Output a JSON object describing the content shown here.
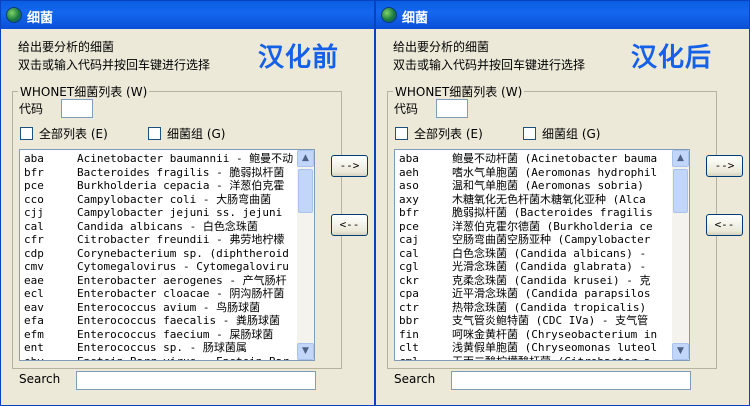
{
  "windows": [
    {
      "title": "细菌",
      "instruction_line1": "给出要分析的细菌",
      "instruction_line2": "双击或输入代码并按回车键进行选择",
      "badge": "汉化前",
      "group_label": "WHONET细菌列表 (W)",
      "code_label": "代码",
      "full_list_label": "全部列表 (E)",
      "group_checkbox_label": "细菌组 (G)",
      "add_button": "-->",
      "remove_button": "<--",
      "search_label": "Search",
      "items": [
        {
          "code": "aba",
          "desc": "Acinetobacter baumannii - 鲍曼不动"
        },
        {
          "code": "bfr",
          "desc": "Bacteroides fragilis - 脆弱拟杆菌"
        },
        {
          "code": "pce",
          "desc": "Burkholderia cepacia - 洋葱伯克霍"
        },
        {
          "code": "cco",
          "desc": "Campylobacter coli - 大肠弯曲菌"
        },
        {
          "code": "cjj",
          "desc": "Campylobacter jejuni ss. jejuni"
        },
        {
          "code": "cal",
          "desc": "Candida albicans - 白色念珠菌"
        },
        {
          "code": "cfr",
          "desc": "Citrobacter freundii - 弗劳地柠檬"
        },
        {
          "code": "cdp",
          "desc": "Corynebacterium sp. (diphtheroid"
        },
        {
          "code": "cmv",
          "desc": "Cytomegalovirus - Cytomegaloviru"
        },
        {
          "code": "eae",
          "desc": "Enterobacter aerogenes - 产气肠杆"
        },
        {
          "code": "ecl",
          "desc": "Enterobacter cloacae - 阴沟肠杆菌"
        },
        {
          "code": "eav",
          "desc": "Enterococcus avium - 鸟肠球菌"
        },
        {
          "code": "efa",
          "desc": "Enterococcus faecalis - 粪肠球菌"
        },
        {
          "code": "efm",
          "desc": "Enterococcus faecium - 屎肠球菌"
        },
        {
          "code": "ent",
          "desc": "Enterococcus sp. - 肠球菌属"
        },
        {
          "code": "ebv",
          "desc": "Epstein-Barr virus - Epstein-Bar"
        }
      ]
    },
    {
      "title": "细菌",
      "instruction_line1": "给出要分析的细菌",
      "instruction_line2": "双击或输入代码并按回车键进行选择",
      "badge": "汉化后",
      "group_label": "WHONET细菌列表 (W)",
      "code_label": "代码",
      "full_list_label": "全部列表 (E)",
      "group_checkbox_label": "细菌组 (G)",
      "add_button": "-->",
      "remove_button": "<--",
      "search_label": "Search",
      "items": [
        {
          "code": "aba",
          "desc": "鲍曼不动杆菌 (Acinetobacter bauma"
        },
        {
          "code": "aeh",
          "desc": "嗜水气单胞菌 (Aeromonas hydrophil"
        },
        {
          "code": "aso",
          "desc": "温和气单胞菌 (Aeromonas sobria)"
        },
        {
          "code": "axy",
          "desc": "木糖氧化无色杆菌木糖氧化亚种 (Alca"
        },
        {
          "code": "bfr",
          "desc": "脆弱拟杆菌 (Bacteroides fragilis"
        },
        {
          "code": "pce",
          "desc": "洋葱伯克霍尔德菌 (Burkholderia ce"
        },
        {
          "code": "caj",
          "desc": "空肠弯曲菌空肠亚种 (Campylobacter"
        },
        {
          "code": "cal",
          "desc": "白色念珠菌 (Candida albicans) -"
        },
        {
          "code": "cgl",
          "desc": "光滑念珠菌 (Candida glabrata) -"
        },
        {
          "code": "ckr",
          "desc": "克柔念珠菌 (Candida krusei) - 克"
        },
        {
          "code": "cpa",
          "desc": "近平滑念珠菌 (Candida parapsilos"
        },
        {
          "code": "ctr",
          "desc": "热带念珠菌 (Candida tropicalis)"
        },
        {
          "code": "bbr",
          "desc": "支气管炎鲍特菌 (CDC IVa) - 支气管"
        },
        {
          "code": "fin",
          "desc": "呵咪金黄杆菌 (Chryseobacterium in"
        },
        {
          "code": "clt",
          "desc": "浅黄假单胞菌 (Chryseomonas luteol"
        },
        {
          "code": "cml",
          "desc": "无丙二酸柠檬酸杆菌 (Citrobacter a"
        }
      ]
    }
  ]
}
